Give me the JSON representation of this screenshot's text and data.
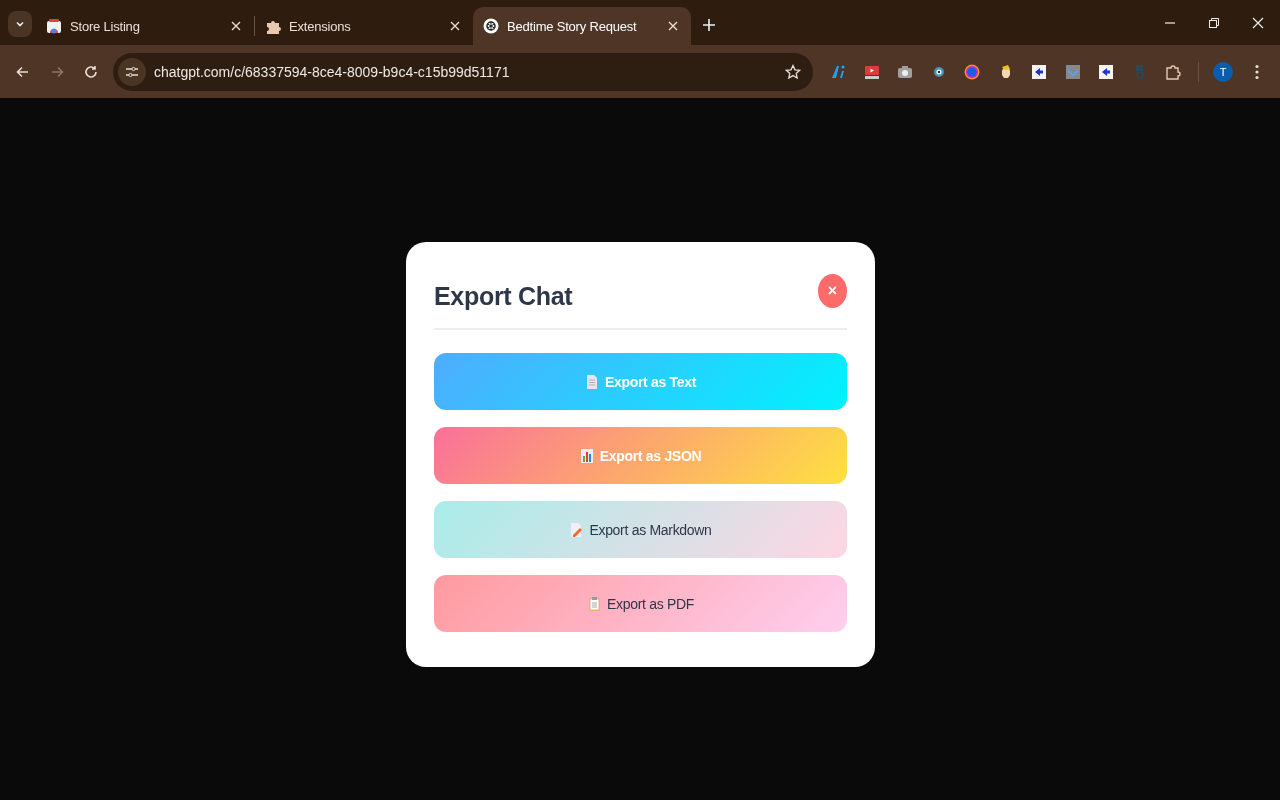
{
  "browser": {
    "tabs": [
      {
        "title": "Store Listing",
        "kind": "store",
        "selected": false
      },
      {
        "title": "Extensions",
        "kind": "puzzle",
        "selected": false
      },
      {
        "title": "Bedtime Story Request",
        "kind": "chat",
        "selected": true
      }
    ],
    "url": "chatgpt.com/c/68337594-8ce4-8009-b9c4-c15b99d51171",
    "profile_initial": "T"
  },
  "dialog": {
    "title": "Export Chat",
    "close_label": "×",
    "buttons": [
      {
        "label": "Export as Text",
        "kind": "text"
      },
      {
        "label": "Export as JSON",
        "kind": "json"
      },
      {
        "label": "Export as Markdown",
        "kind": "markdown"
      },
      {
        "label": "Export as PDF",
        "kind": "pdf"
      }
    ]
  }
}
